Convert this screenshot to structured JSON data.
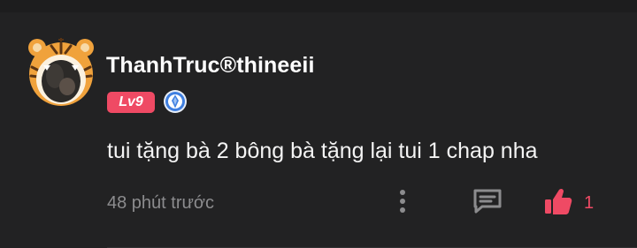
{
  "comment": {
    "username": "ThanhTruc®thineeii",
    "level": "Lv9",
    "text": "tui tặng bà 2 bông bà tặng lại tui 1 chap nha",
    "timestamp": "48 phút trước",
    "like_count": "1"
  },
  "icons": {
    "avatar": "tiger-avatar",
    "rank_badge": "blue-gem-badge-icon",
    "more": "vertical-dots-icon",
    "reply": "speech-bubble-icon",
    "like": "thumbs-up-icon"
  },
  "colors": {
    "background": "#222223",
    "accent": "#ef4a64",
    "muted_text": "#8c8c8e",
    "badge_blue": "#3f7fe0"
  }
}
